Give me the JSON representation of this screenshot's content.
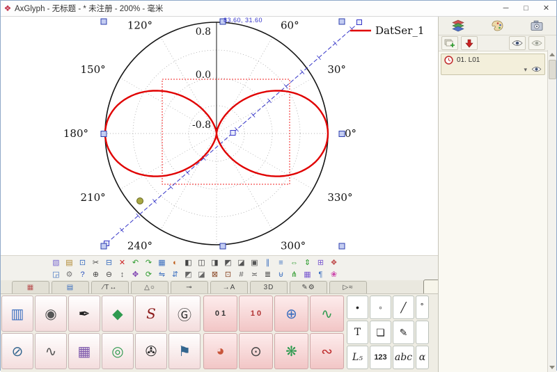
{
  "window": {
    "title": "AxGlyph - 无标题 - * 未注册 - 200% - 毫米",
    "controls": {
      "minimize": "─",
      "maximize": "□",
      "close": "✕"
    }
  },
  "canvas": {
    "coord_readout": "83.60, 31.60"
  },
  "chart_data": {
    "type": "line",
    "coordinate_system": "polar",
    "title": "",
    "series": [
      {
        "name": "DatSer_1",
        "color": "#e00000",
        "function": "r(theta) = 0.8*cos(2*theta)",
        "amplitude": 0.8,
        "frequency": 2,
        "samples": [
          {
            "theta_deg": 0,
            "r": 0.8
          },
          {
            "theta_deg": 30,
            "r": 0.4
          },
          {
            "theta_deg": 45,
            "r": 0.0
          },
          {
            "theta_deg": 60,
            "r": -0.4
          },
          {
            "theta_deg": 90,
            "r": -0.8
          },
          {
            "theta_deg": 120,
            "r": -0.4
          },
          {
            "theta_deg": 135,
            "r": 0.0
          },
          {
            "theta_deg": 150,
            "r": 0.4
          },
          {
            "theta_deg": 180,
            "r": 0.8
          },
          {
            "theta_deg": 210,
            "r": 0.4
          },
          {
            "theta_deg": 240,
            "r": -0.4
          },
          {
            "theta_deg": 270,
            "r": -0.8
          },
          {
            "theta_deg": 300,
            "r": -0.4
          },
          {
            "theta_deg": 330,
            "r": 0.4
          },
          {
            "theta_deg": 360,
            "r": 0.8
          }
        ]
      }
    ],
    "angular_ticks_deg": [
      0,
      30,
      60,
      120,
      150,
      180,
      210,
      240,
      300,
      330
    ],
    "angular_tick_suffix": "°",
    "radial_ticks": [
      "0.8",
      "0.0",
      "-0.8"
    ],
    "radial_tick_values": [
      0.8,
      0.0,
      -0.8
    ],
    "radial_range": [
      -0.8,
      0.8
    ],
    "grid": true,
    "legend_position": "top-right"
  },
  "toolbar_row1": [
    {
      "n": "paste-tool",
      "g": "▧",
      "c": "#7a6ad0"
    },
    {
      "n": "card-view",
      "g": "▤",
      "c": "#b08830"
    },
    {
      "n": "copy",
      "g": "⊡",
      "c": "#3a6ebf"
    },
    {
      "n": "cut",
      "g": "✂",
      "c": "#444444"
    },
    {
      "n": "clipboard",
      "g": "⊟",
      "c": "#3a6ebf"
    },
    {
      "n": "delete",
      "g": "✕",
      "c": "#cc2222"
    },
    {
      "n": "undo",
      "g": "↶",
      "c": "#2a9a2a"
    },
    {
      "n": "redo",
      "g": "↷",
      "c": "#2a9a2a"
    },
    {
      "n": "grid-toggle",
      "g": "▦",
      "c": "#3a6ebf"
    },
    {
      "n": "color-wheel",
      "g": "◐",
      "c": "#c06020"
    },
    {
      "n": "align-left",
      "g": "◧",
      "c": "#444444"
    },
    {
      "n": "align-center",
      "g": "◫",
      "c": "#444444"
    },
    {
      "n": "align-right",
      "g": "◨",
      "c": "#444444"
    },
    {
      "n": "align-top",
      "g": "◩",
      "c": "#555555"
    },
    {
      "n": "align-bottom",
      "g": "◪",
      "c": "#555555"
    },
    {
      "n": "frame",
      "g": "▣",
      "c": "#555555"
    },
    {
      "n": "distribute-h",
      "g": "∥",
      "c": "#3a6ebf"
    },
    {
      "n": "distribute-v",
      "g": "≡",
      "c": "#3a6ebf"
    },
    {
      "n": "equal-width",
      "g": "⇔",
      "c": "#2a9a2a"
    },
    {
      "n": "equal-height",
      "g": "⇕",
      "c": "#2a9a2a"
    },
    {
      "n": "group-objects",
      "g": "⊞",
      "c": "#7a5ad0"
    },
    {
      "n": "color-grid",
      "g": "❖",
      "c": "#c05050"
    }
  ],
  "toolbar_row2": [
    {
      "n": "save",
      "g": "◲",
      "c": "#3a6ebf"
    },
    {
      "n": "settings",
      "g": "⚙",
      "c": "#777777"
    },
    {
      "n": "help",
      "g": "?",
      "c": "#2a52be"
    },
    {
      "n": "zoom-in",
      "g": "⊕",
      "c": "#444444"
    },
    {
      "n": "zoom-out",
      "g": "⊖",
      "c": "#444444"
    },
    {
      "n": "fit-view",
      "g": "↕",
      "c": "#555555"
    },
    {
      "n": "pan",
      "g": "✥",
      "c": "#7a3ab0"
    },
    {
      "n": "rotate",
      "g": "⟳",
      "c": "#2a9a2a"
    },
    {
      "n": "flip-horizontal",
      "g": "⇋",
      "c": "#3a6ebf"
    },
    {
      "n": "flip-vertical",
      "g": "⇵",
      "c": "#3a6ebf"
    },
    {
      "n": "bring-front",
      "g": "◩",
      "c": "#666666"
    },
    {
      "n": "send-back",
      "g": "◪",
      "c": "#666666"
    },
    {
      "n": "lock",
      "g": "⊠",
      "c": "#884422"
    },
    {
      "n": "unlock",
      "g": "⊡",
      "c": "#884422"
    },
    {
      "n": "snap-grid",
      "g": "#",
      "c": "#555555"
    },
    {
      "n": "match-size",
      "g": "≍",
      "c": "#555555"
    },
    {
      "n": "layers-list",
      "g": "≣",
      "c": "#444444"
    },
    {
      "n": "merge",
      "g": "⊎",
      "c": "#3a6ebf"
    },
    {
      "n": "split",
      "g": "⋔",
      "c": "#2a9a2a"
    },
    {
      "n": "table",
      "g": "▦",
      "c": "#7a5ad0"
    },
    {
      "n": "paragraph",
      "g": "¶",
      "c": "#3a6ebf"
    },
    {
      "n": "flower-palette",
      "g": "❀",
      "c": "#cc44aa"
    }
  ],
  "tabs": [
    {
      "n": "tab-color-grid-left",
      "g": "▦",
      "c": "#b85050"
    },
    {
      "n": "tab-media",
      "g": "▤",
      "c": "#3a6ebf"
    },
    {
      "n": "tab-text-lines",
      "g": "⁄T↔",
      "c": "#444444"
    },
    {
      "n": "tab-shapes",
      "g": "△○",
      "c": "#444444"
    },
    {
      "n": "tab-connectors",
      "g": "⊸",
      "c": "#444444"
    },
    {
      "n": "tab-arrows",
      "g": "→A",
      "c": "#444444"
    },
    {
      "n": "tab-3d",
      "g": "3D",
      "c": "#444444"
    },
    {
      "n": "tab-draw-settings",
      "g": "✎⚙",
      "c": "#444444"
    },
    {
      "n": "tab-flow",
      "g": "▷≈",
      "c": "#444444"
    },
    {
      "n": "tab-color-grid-right",
      "g": "▦",
      "c": "#b85050",
      "active": true,
      "gap": true
    }
  ],
  "palette": {
    "section_a": [
      {
        "n": "image-tool",
        "g": "▥",
        "c": "#3a6ebf"
      },
      {
        "n": "screenshot-tool",
        "g": "◉",
        "c": "#555555"
      },
      {
        "n": "pen-nib-tool",
        "g": "✒",
        "c": "#222222"
      },
      {
        "n": "solid3d-tool",
        "g": "◆",
        "c": "#2f9a4f"
      },
      {
        "n": "freehand-tool",
        "g": "S",
        "c": "#8b1a1a",
        "cls": "itserif"
      },
      {
        "n": "monogram-tool",
        "g": "Ⓖ",
        "c": "#333333"
      },
      {
        "n": "ellipse-tool",
        "g": "⊘",
        "c": "#33668f"
      },
      {
        "n": "curve-node-tool",
        "g": "∿",
        "c": "#555555"
      },
      {
        "n": "node-grid-tool",
        "g": "▦",
        "c": "#7a55aa"
      },
      {
        "n": "ring-tool",
        "g": "◎",
        "c": "#2f9a4f"
      },
      {
        "n": "spiral-shell-tool",
        "g": "✇",
        "c": "#222222"
      },
      {
        "n": "flag-chart-tool",
        "g": "⚑",
        "c": "#33668f"
      }
    ],
    "section_b": [
      {
        "n": "number-line-tool",
        "g": "0 1",
        "c": "#333333",
        "cls": "small"
      },
      {
        "n": "colorbar-tool",
        "g": "1 0",
        "c": "#b03030",
        "cls": "small"
      },
      {
        "n": "axes-plot-tool",
        "g": "⊕",
        "c": "#3a6ebf"
      },
      {
        "n": "line-chart-tool",
        "g": "∿",
        "c": "#2f9a4f"
      },
      {
        "n": "pie-chart-tool",
        "g": "◕",
        "c": "#c8553a"
      },
      {
        "n": "polar-plot-tool",
        "g": "⊙",
        "c": "#444444"
      },
      {
        "n": "scatter3d-tool",
        "g": "❋",
        "c": "#2f9a4f"
      },
      {
        "n": "spring-tool",
        "g": "∾",
        "c": "#c03030"
      }
    ],
    "section_c": [
      {
        "n": "point-tool",
        "g": "•",
        "c": "#222222"
      },
      {
        "n": "small-circle-tool",
        "g": "◦",
        "c": "#222222"
      },
      {
        "n": "line-tool",
        "g": "╱",
        "c": "#222222"
      },
      {
        "n": "degree-tool",
        "g": "˚",
        "c": "#222222"
      },
      {
        "n": "text-tool",
        "g": "T",
        "c": "#222222",
        "cls": "serif"
      },
      {
        "n": "callout-tool",
        "g": "❏",
        "c": "#222222"
      },
      {
        "n": "pencil-tool",
        "g": "✎",
        "c": "#222222"
      },
      {
        "n": "blank-tool",
        "g": "",
        "c": "#222222"
      },
      {
        "n": "label-subscript-tool",
        "g": "L₅",
        "c": "#222222",
        "cls": "itserif"
      },
      {
        "n": "numbers-tool",
        "g": "123",
        "c": "#222222",
        "cls": "small"
      },
      {
        "n": "letters-tool",
        "g": "abc",
        "c": "#222222",
        "cls": "itserif"
      },
      {
        "n": "alpha-tool",
        "g": "α",
        "c": "#222222",
        "cls": "itserif"
      }
    ]
  },
  "right_panel": {
    "layer": {
      "label": "01. L01"
    }
  },
  "icons": {
    "app": "❖",
    "dropdown": "▾"
  }
}
